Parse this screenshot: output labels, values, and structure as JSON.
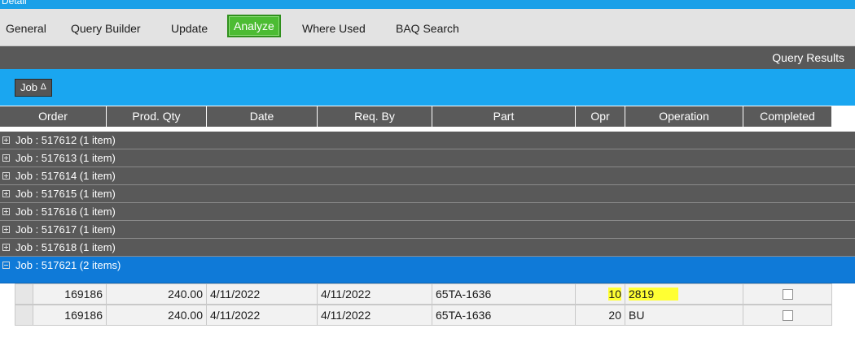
{
  "window": {
    "title": "Detail"
  },
  "tabs": [
    {
      "label": "General"
    },
    {
      "label": "Query Builder"
    },
    {
      "label": "Update"
    },
    {
      "label": "Analyze",
      "active": true
    },
    {
      "label": "Where Used"
    },
    {
      "label": "BAQ Search"
    }
  ],
  "results": {
    "title": "Query Results"
  },
  "group_by": {
    "chip_label": "Job",
    "sort_glyph": "Δ"
  },
  "columns": [
    "Order",
    "Prod. Qty",
    "Date",
    "Req. By",
    "Part",
    "Opr",
    "Operation",
    "Completed"
  ],
  "groups": [
    {
      "label": "Job : 517612 (1 item)",
      "expanded": false
    },
    {
      "label": "Job : 517613 (1 item)",
      "expanded": false
    },
    {
      "label": "Job : 517614 (1 item)",
      "expanded": false
    },
    {
      "label": "Job : 517615 (1 item)",
      "expanded": false
    },
    {
      "label": "Job : 517616 (1 item)",
      "expanded": false
    },
    {
      "label": "Job : 517617 (1 item)",
      "expanded": false
    },
    {
      "label": "Job : 517618 (1 item)",
      "expanded": false
    },
    {
      "label": "Job : 517621 (2 items)",
      "expanded": true
    }
  ],
  "rows": [
    {
      "order": "169186",
      "prod_qty": "240.00",
      "date": "4/11/2022",
      "req_by": "4/11/2022",
      "part": "65TA-1636",
      "opr": "10",
      "operation": "2819",
      "completed": false
    },
    {
      "order": "169186",
      "prod_qty": "240.00",
      "date": "4/11/2022",
      "req_by": "4/11/2022",
      "part": "65TA-1636",
      "opr": "20",
      "operation": "BU",
      "completed": false
    }
  ],
  "colors": {
    "accent_blue": "#1aa6f0",
    "selected_group": "#0f7ad8",
    "active_tab": "#4cbc33",
    "header_gray": "#595959",
    "highlight": "#ffff33"
  }
}
